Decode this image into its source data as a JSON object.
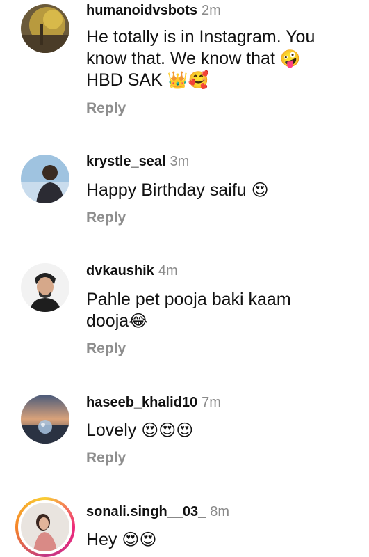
{
  "reply_label": "Reply",
  "comments": [
    {
      "username": "humanoidvsbots",
      "time": "2m",
      "text_line1": "He totally is in Instagram. You",
      "text_line2": "know that. We know that",
      "text_line2_emoji": "🤪",
      "text_line3": "HBD SAK",
      "text_line3_emoji": "👑🥰"
    },
    {
      "username": "krystle_seal",
      "time": "3m",
      "text": "Happy Birthday saifu",
      "text_emoji": "😍"
    },
    {
      "username": "dvkaushik",
      "time": "4m",
      "text_line1": "Pahle pet pooja baki kaam",
      "text_line2": "dooja",
      "text_line2_emoji": "😂"
    },
    {
      "username": "haseeb_khalid10",
      "time": "7m",
      "text": "Lovely",
      "text_emoji": "😍😍😍"
    },
    {
      "username": "sonali.singh__03_",
      "time": "8m",
      "text": "Hey",
      "text_emoji": "😍😍"
    }
  ],
  "colors": {
    "username": "#111111",
    "timestamp": "#8a8a8a",
    "reply": "#8e8e8e",
    "story_ring": [
      "#f9ce34",
      "#ee2a7b",
      "#c13584",
      "#f58529"
    ]
  }
}
